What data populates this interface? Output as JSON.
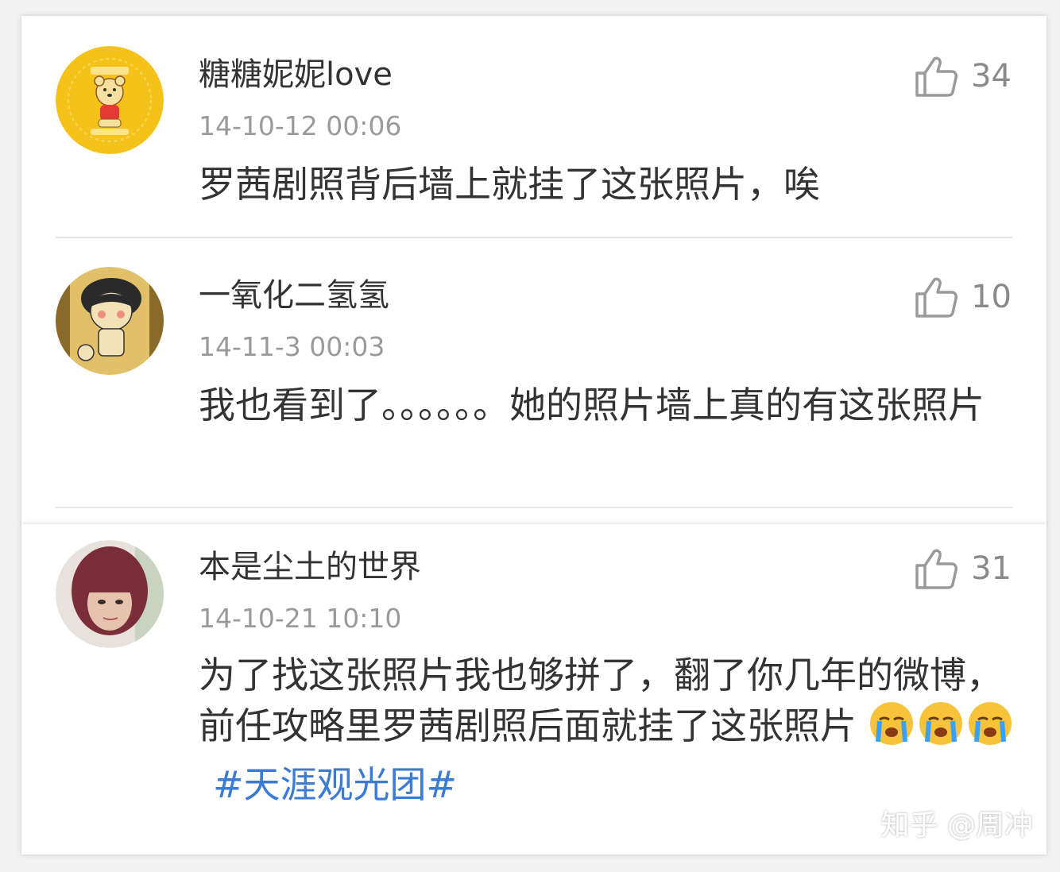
{
  "comments": [
    {
      "username": "糖糖妮妮love",
      "time": "14-10-12 00:06",
      "likes": "34",
      "text": "罗茜剧照背后墙上就挂了这张照片，唉",
      "avatar_icon": "winnie-the-pooh-avatar",
      "avatar_color": "#f5c21a"
    },
    {
      "username": "一氧化二氢氢",
      "time": "14-11-3 00:03",
      "likes": "10",
      "text": "我也看到了。。。。。。她的照片墙上真的有这张照片",
      "avatar_icon": "cartoon-girl-avatar",
      "avatar_color": "#d9b35a"
    },
    {
      "username": "本是尘土的世界",
      "time": "14-10-21 10:10",
      "likes": "31",
      "text": "为了找这张照片我也够拼了，翻了你几年的微博，前任攻略里罗茜剧照后面就挂了这张照片",
      "emojis": [
        "crying-face-emoji",
        "crying-face-emoji",
        "crying-face-emoji"
      ],
      "topic": "#天涯观光团#",
      "avatar_icon": "person-photo-avatar",
      "avatar_color": "#7a3a3a"
    }
  ],
  "watermark": "知乎 @周冲",
  "colors": {
    "topic_link": "#3a7bd5",
    "username": "#333333",
    "timestamp": "#9a9a9a"
  }
}
